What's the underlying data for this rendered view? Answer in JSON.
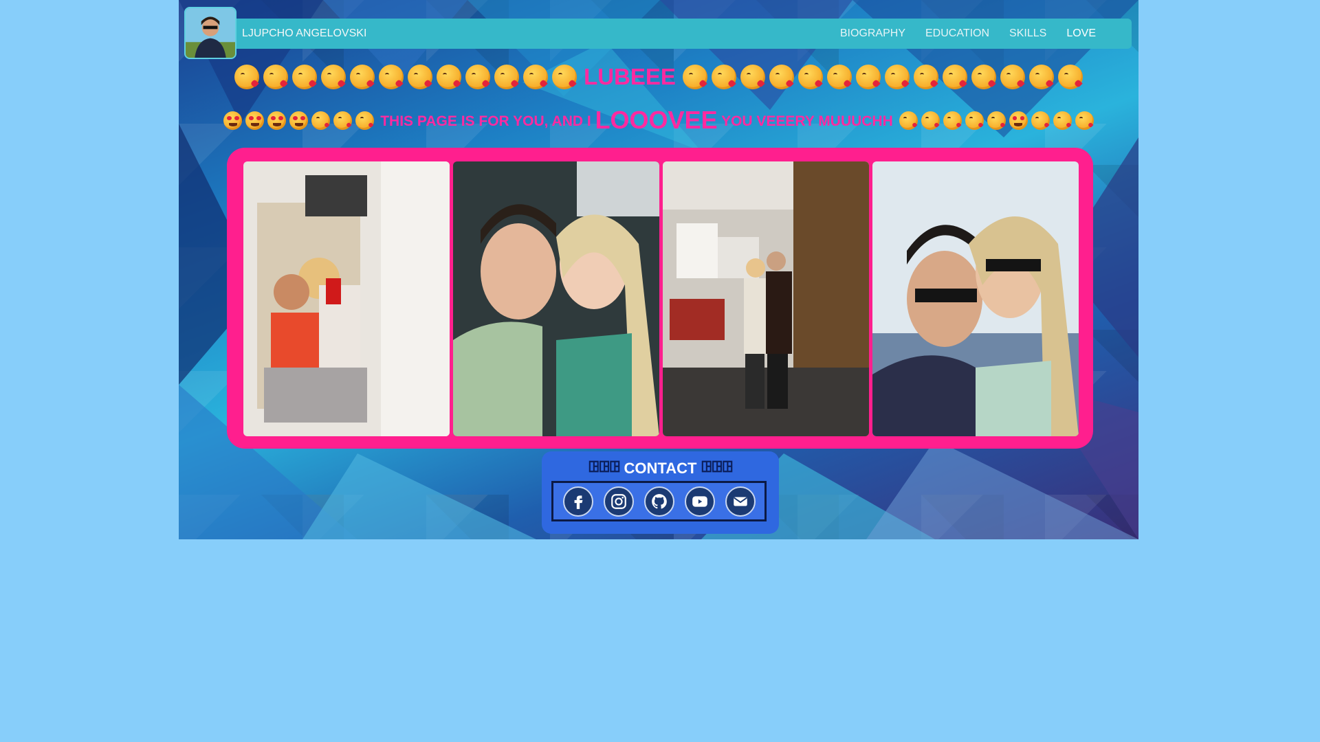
{
  "header": {
    "brand": "LJUPCHO ANGELOVSKI",
    "nav": [
      {
        "label": "BIOGRAPHY",
        "active": false
      },
      {
        "label": "EDUCATION",
        "active": false
      },
      {
        "label": "SKILLS",
        "active": false
      },
      {
        "label": "LOVE",
        "active": true
      }
    ]
  },
  "headline": {
    "text": "LUBEEE",
    "emoji_icon": "face-blowing-a-kiss-icon",
    "left_count": 12,
    "right_count": 14
  },
  "subline": {
    "part1": "THIS PAGE IS FOR YOU, AND I",
    "big": "LOOOVEE",
    "part2": "YOU VEEERY MUUUCHH"
  },
  "gallery": {
    "photos": [
      {
        "name": "couple-mirror-selfie-photo"
      },
      {
        "name": "couple-closeup-selfie-photo"
      },
      {
        "name": "couple-hallway-mirror-photo"
      },
      {
        "name": "couple-sunglasses-selfie-photo"
      }
    ]
  },
  "contact": {
    "title": "CONTACT",
    "links": [
      {
        "icon": "facebook-icon"
      },
      {
        "icon": "instagram-icon"
      },
      {
        "icon": "github-icon"
      },
      {
        "icon": "youtube-icon"
      },
      {
        "icon": "email-icon"
      }
    ]
  },
  "colors": {
    "page_background": "#87cefa",
    "navbar": "#36b8c9",
    "accent_pink": "#ff2aa0",
    "gallery_frame": "#ff1f8e",
    "contact_box": "#2f68e0"
  }
}
